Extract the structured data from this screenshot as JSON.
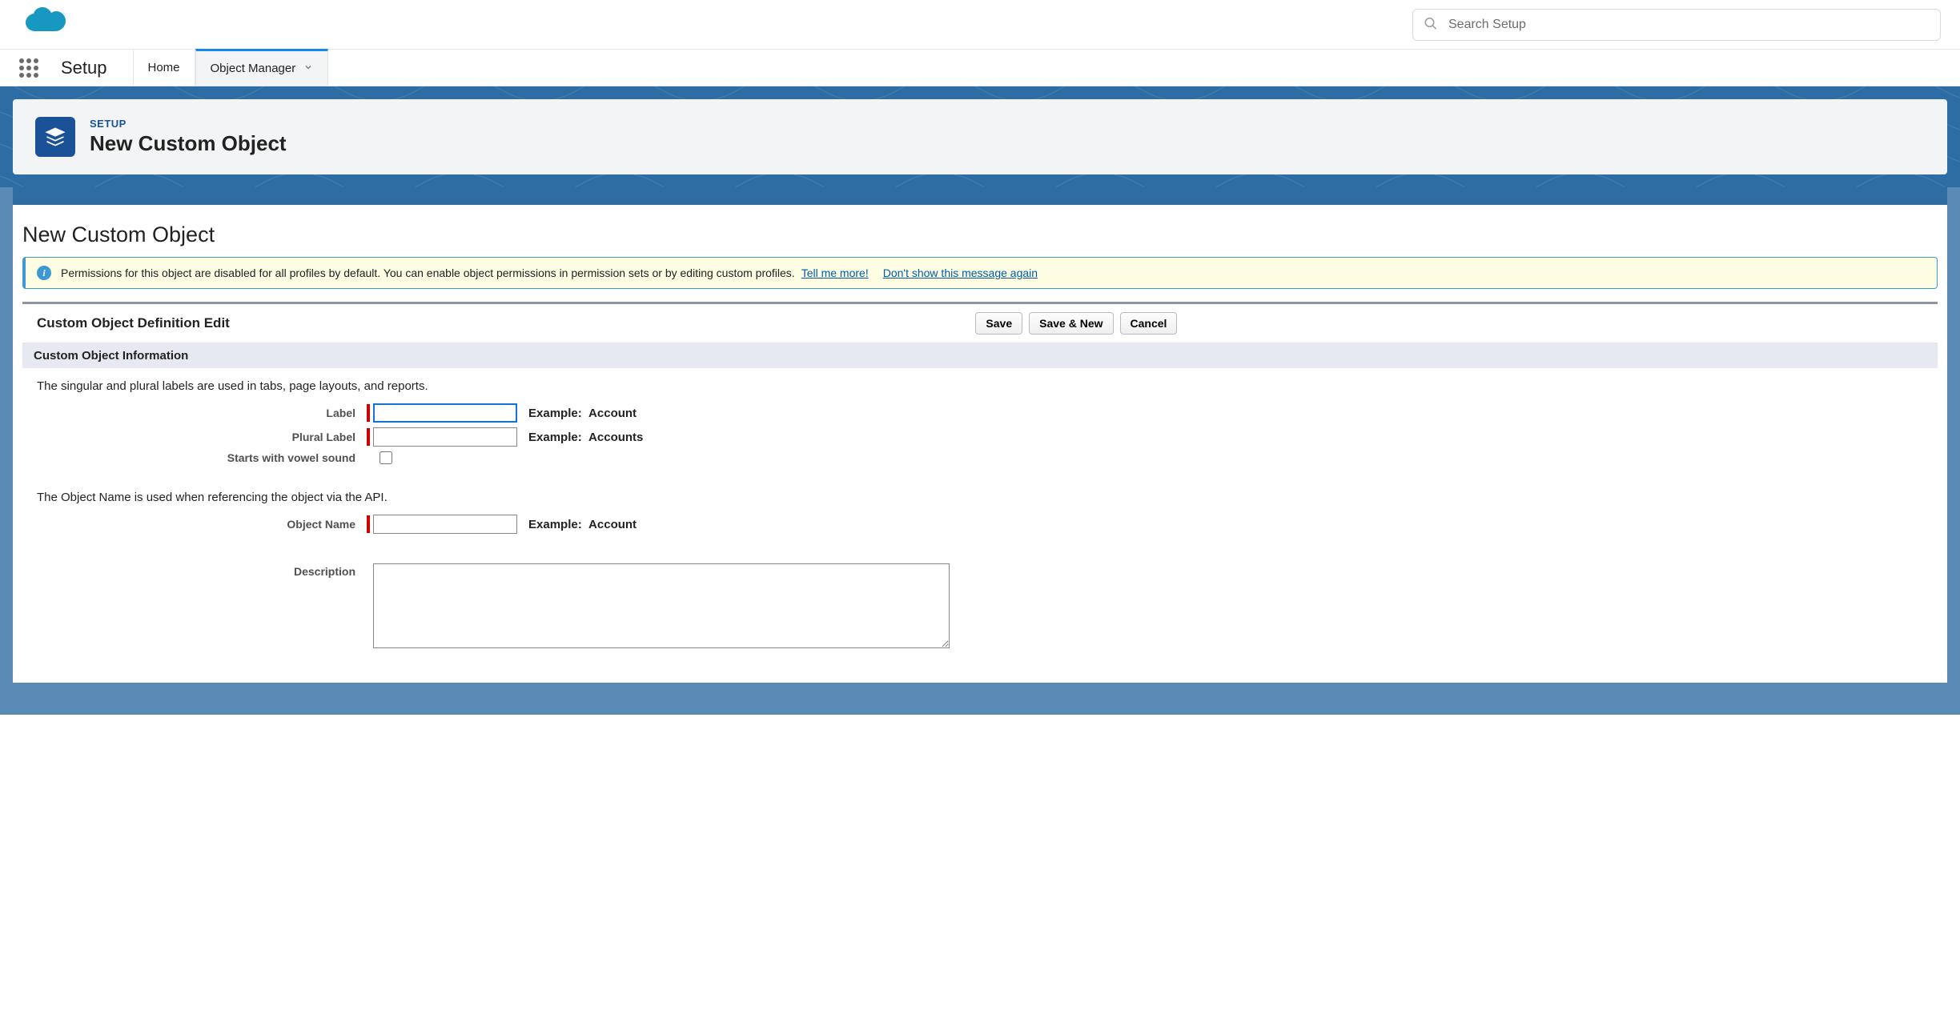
{
  "header": {
    "search_placeholder": "Search Setup"
  },
  "nav": {
    "app_name": "Setup",
    "tabs": {
      "home": "Home",
      "object_manager": "Object Manager"
    }
  },
  "page": {
    "breadcrumb": "SETUP",
    "title": "New Custom Object"
  },
  "panel": {
    "heading": "New Custom Object"
  },
  "banner": {
    "text": "Permissions for this object are disabled for all profiles by default. You can enable object permissions in permission sets or by editing custom profiles.",
    "link1": "Tell me more!",
    "link2": "Don't show this message again"
  },
  "section": {
    "edit_title": "Custom Object Definition Edit",
    "buttons": {
      "save": "Save",
      "save_new": "Save & New",
      "cancel": "Cancel"
    },
    "sub_title": "Custom Object Information"
  },
  "form": {
    "labels_help": "The singular and plural labels are used in tabs, page layouts, and reports.",
    "label": "Label",
    "label_example_prefix": "Example:",
    "label_example": "Account",
    "plural_label": "Plural Label",
    "plural_example": "Accounts",
    "vowel": "Starts with vowel sound",
    "api_help": "The Object Name is used when referencing the object via the API.",
    "object_name": "Object Name",
    "object_name_example": "Account",
    "description": "Description"
  }
}
